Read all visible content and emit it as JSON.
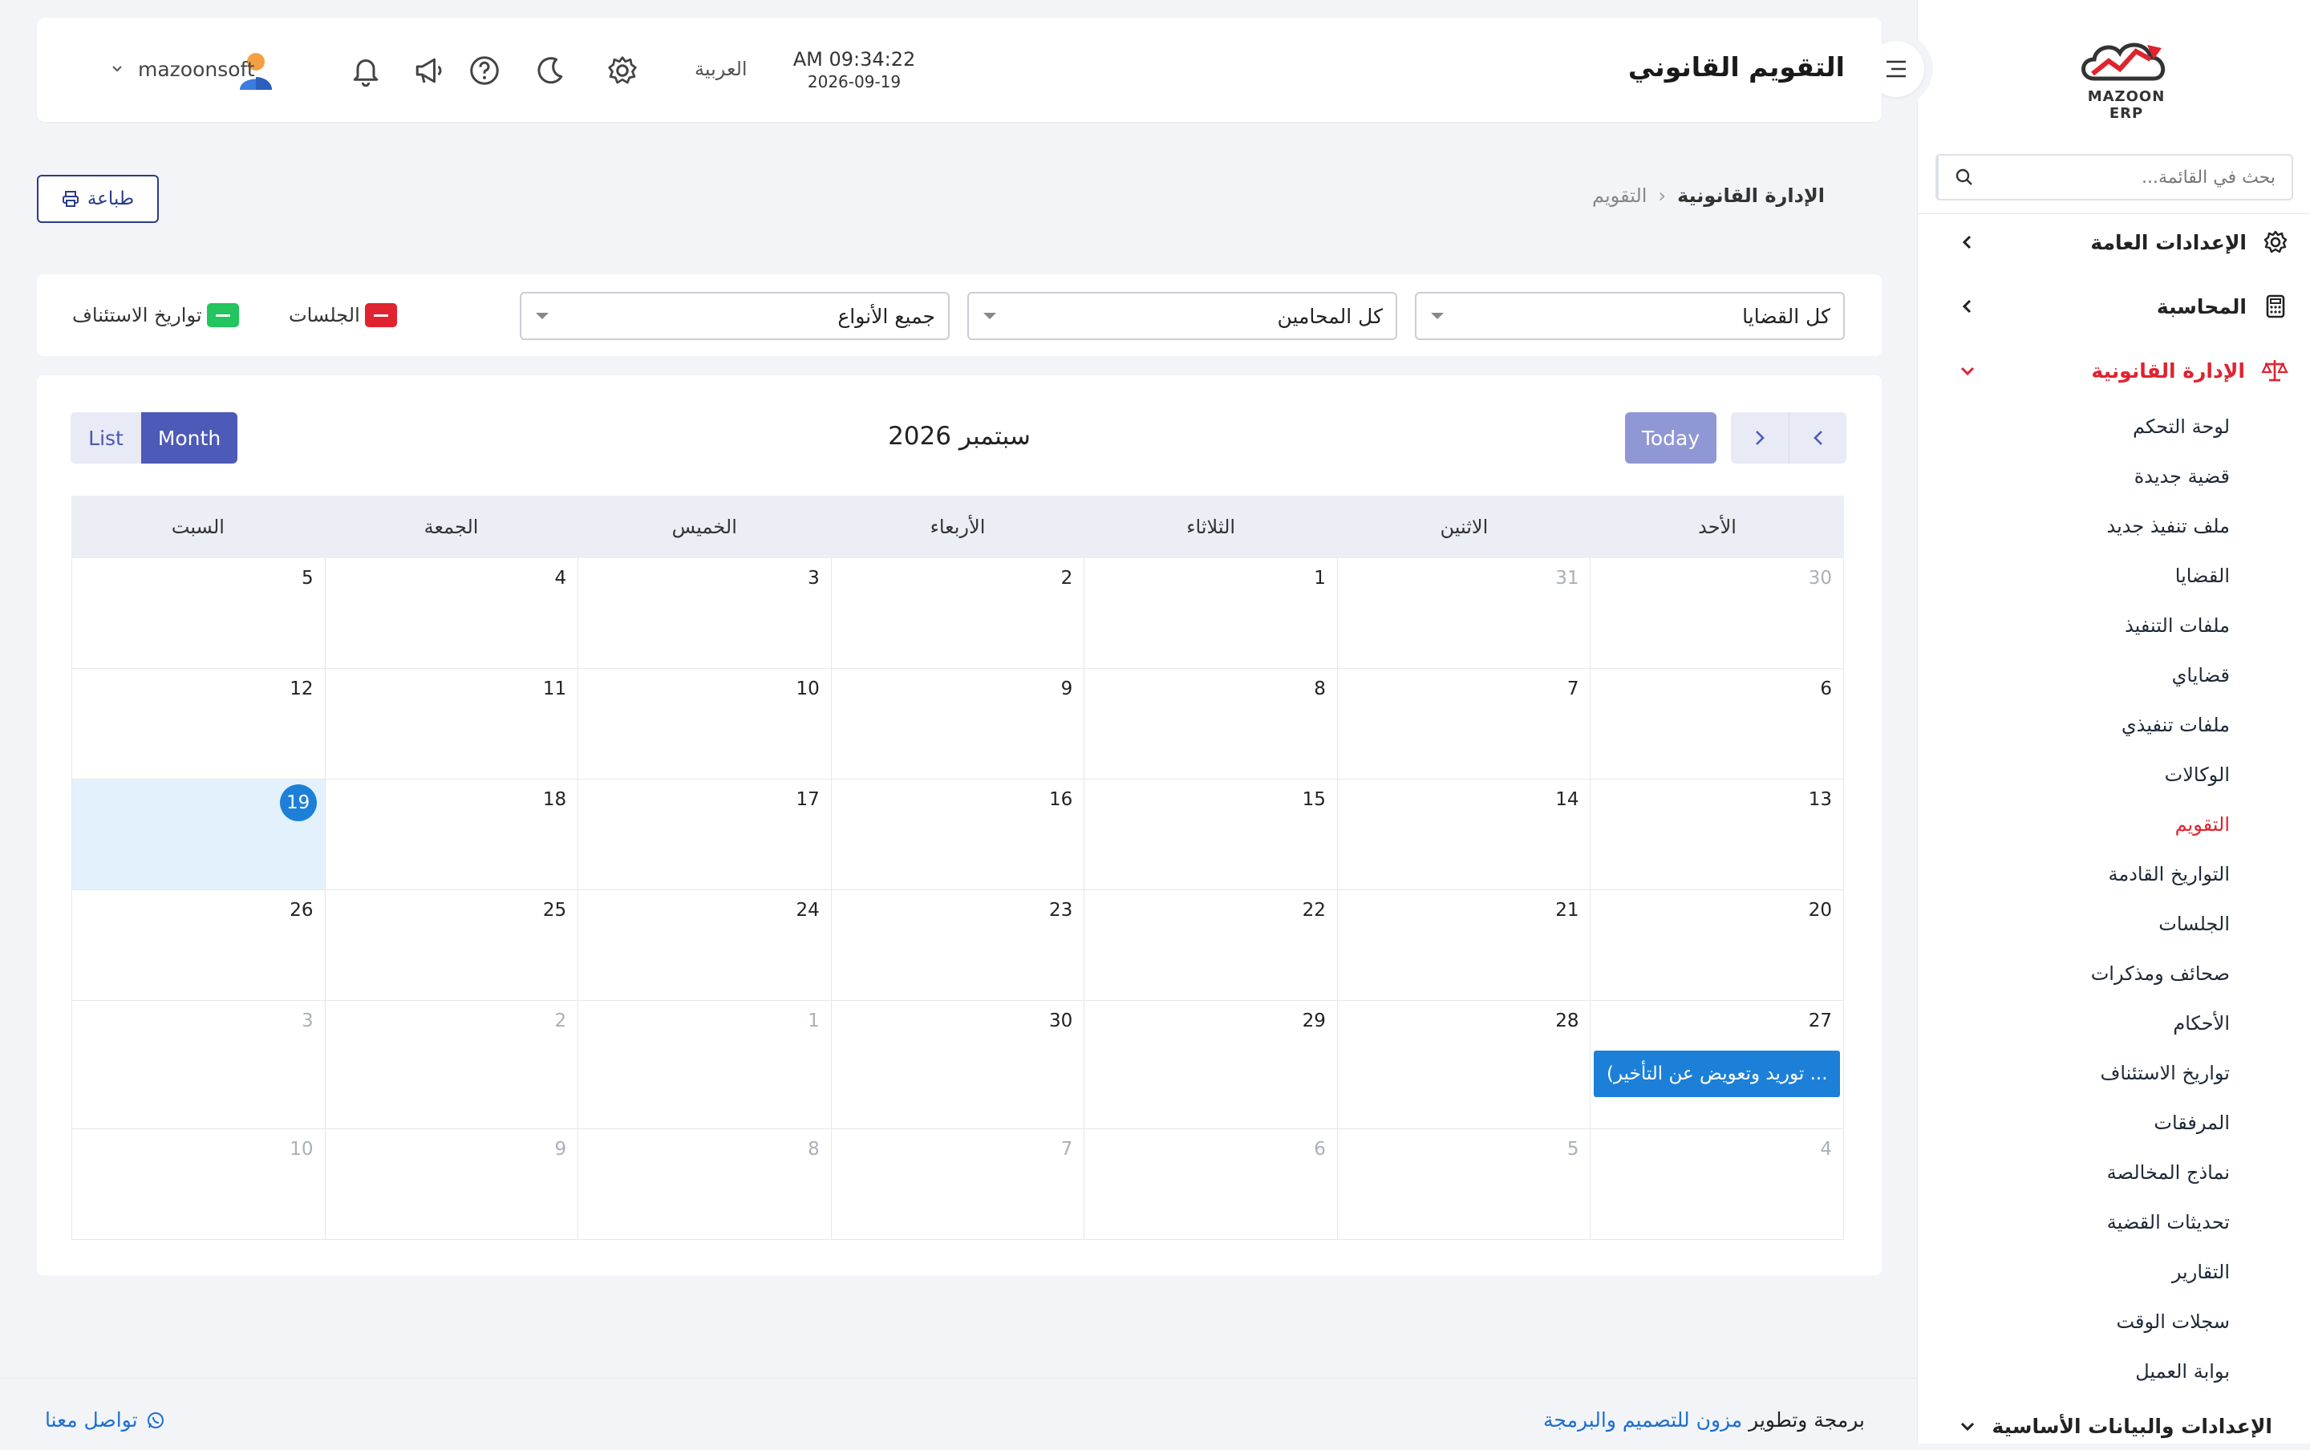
{
  "sidebar": {
    "logo_text": "MAZOON ERP",
    "search_placeholder": "بحث في القائمة...",
    "groups": [
      {
        "label": "الإعدادات العامة"
      },
      {
        "label": "المحاسبة"
      },
      {
        "label": "الإدارة القانونية"
      }
    ],
    "items": [
      "لوحة التحكم",
      "قضية جديدة",
      "ملف تنفيذ جديد",
      "القضايا",
      "ملفات التنفيذ",
      "قضاياي",
      "ملفات تنفيذي",
      "الوكالات",
      "التقويم",
      "التواريخ القادمة",
      "الجلسات",
      "صحائف ومذكرات",
      "الأحكام",
      "تواريخ الاستئناف",
      "المرفقات",
      "نماذج المخالصة",
      "تحديثات القضية",
      "التقارير",
      "سجلات الوقت",
      "بوابة العميل"
    ],
    "bottom_group": "الإعدادات والبيانات الأساسية"
  },
  "header": {
    "title": "التقويم القانوني",
    "time": "AM 09:34:22",
    "date": "2026-09-19",
    "language": "العربية",
    "username": "mazoonsoft"
  },
  "breadcrumb": {
    "parent": "الإدارة القانونية",
    "current": "التقويم"
  },
  "toolbar": {
    "print_label": "طباعة"
  },
  "filters": {
    "cases": "كل القضايا",
    "lawyers": "كل المحامين",
    "types": "جميع الأنواع",
    "legend": [
      {
        "label": "الجلسات",
        "color": "#e0232f"
      },
      {
        "label": "تواريخ الاستئناف",
        "color": "#22c55e"
      }
    ]
  },
  "calendar": {
    "title": "سبتمبر 2026",
    "today_label": "Today",
    "month_label": "Month",
    "list_label": "List",
    "weekdays": [
      "السبت",
      "الجمعة",
      "الخميس",
      "الأربعاء",
      "الثلاثاء",
      "الاثنين",
      "الأحد"
    ],
    "weeks": [
      [
        {
          "d": "5"
        },
        {
          "d": "4"
        },
        {
          "d": "3"
        },
        {
          "d": "2"
        },
        {
          "d": "1"
        },
        {
          "d": "31",
          "other": true
        },
        {
          "d": "30",
          "other": true
        }
      ],
      [
        {
          "d": "12"
        },
        {
          "d": "11"
        },
        {
          "d": "10"
        },
        {
          "d": "9"
        },
        {
          "d": "8"
        },
        {
          "d": "7"
        },
        {
          "d": "6"
        }
      ],
      [
        {
          "d": "19",
          "today": true
        },
        {
          "d": "18"
        },
        {
          "d": "17"
        },
        {
          "d": "16"
        },
        {
          "d": "15"
        },
        {
          "d": "14"
        },
        {
          "d": "13"
        }
      ],
      [
        {
          "d": "26"
        },
        {
          "d": "25"
        },
        {
          "d": "24"
        },
        {
          "d": "23"
        },
        {
          "d": "22"
        },
        {
          "d": "21"
        },
        {
          "d": "20"
        }
      ],
      [
        {
          "d": "3",
          "other": true
        },
        {
          "d": "2",
          "other": true
        },
        {
          "d": "1",
          "other": true
        },
        {
          "d": "30"
        },
        {
          "d": "29"
        },
        {
          "d": "28"
        },
        {
          "d": "27",
          "event": "... توريد وتعويض عن التأخير)"
        }
      ],
      [
        {
          "d": "10",
          "other": true
        },
        {
          "d": "9",
          "other": true
        },
        {
          "d": "8",
          "other": true
        },
        {
          "d": "7",
          "other": true
        },
        {
          "d": "6",
          "other": true
        },
        {
          "d": "5",
          "other": true
        },
        {
          "d": "4",
          "other": true
        }
      ]
    ]
  },
  "footer": {
    "prefix": "برمجة وتطوير",
    "company": "مزون للتصميم والبرمجة",
    "contact": "تواصل معنا"
  }
}
